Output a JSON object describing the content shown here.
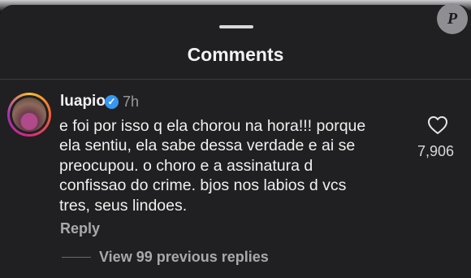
{
  "header": {
    "title": "Comments",
    "watermark": "P"
  },
  "comment": {
    "username": "luapio",
    "verified": true,
    "time": "7h",
    "lines": [
      "e foi por isso q ela chorou na hora!!! porque",
      "ela sentiu, ela sabe dessa verdade e ai se",
      "preocupou. o choro e a assinatura d",
      "confissao do crime. bjos nos labios d vcs",
      "tres, seus lindoes."
    ],
    "likes": "7,906",
    "reply_label": "Reply",
    "view_replies_label": "View 99 previous replies"
  },
  "icons": {
    "like": "heart-outline-icon",
    "verified": "verified-badge-icon"
  },
  "colors": {
    "background": "#202022",
    "verified_blue": "#3797f0",
    "text": "#f0f0f0",
    "muted": "#a9a9ad"
  }
}
